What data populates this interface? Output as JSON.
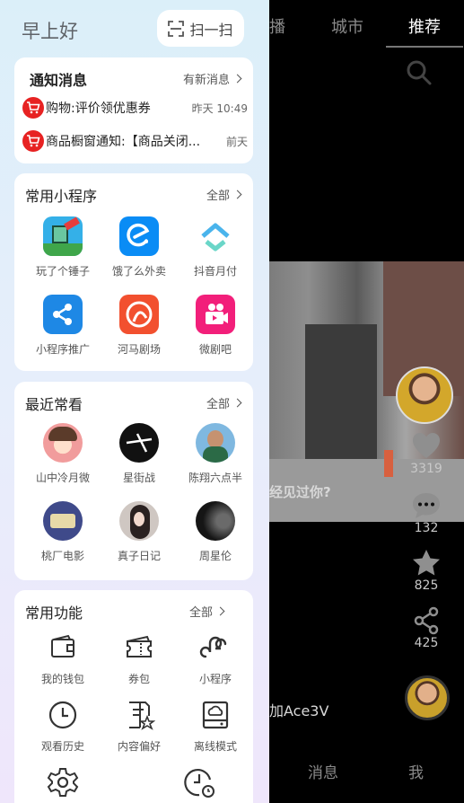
{
  "background": {
    "tabs": [
      "播",
      "城市",
      "推荐"
    ],
    "caption": "经见过你?",
    "stats": {
      "likes": "3319",
      "comments": "132",
      "favorites": "825",
      "shares": "425"
    },
    "nickname": "加Ace3V",
    "nav": [
      "消息",
      "我"
    ]
  },
  "drawer": {
    "greeting": "早上好",
    "scan_label": "扫一扫",
    "notifications": {
      "title": "通知消息",
      "more": "有新消息",
      "items": [
        {
          "text": "购物:评价领优惠券",
          "time": "昨天 10:49"
        },
        {
          "text": "商品橱窗通知:【商品关闭...",
          "time": "前天"
        }
      ]
    },
    "mini_programs": {
      "title": "常用小程序",
      "more": "全部",
      "items": [
        {
          "label": "玩了个锤子",
          "icon": "hammer-game-icon"
        },
        {
          "label": "饿了么外卖",
          "icon": "eleme-icon"
        },
        {
          "label": "抖音月付",
          "icon": "douyin-pay-icon"
        },
        {
          "label": "小程序推广",
          "icon": "share-promo-icon"
        },
        {
          "label": "河马剧场",
          "icon": "hippo-theater-icon"
        },
        {
          "label": "微剧吧",
          "icon": "video-camera-icon"
        }
      ]
    },
    "recent": {
      "title": "最近常看",
      "more": "全部",
      "items": [
        {
          "label": "山中冷月微"
        },
        {
          "label": "星街战"
        },
        {
          "label": "陈翔六点半"
        },
        {
          "label": "桃厂电影"
        },
        {
          "label": "真子日记"
        },
        {
          "label": "周星伦"
        }
      ]
    },
    "functions": {
      "title": "常用功能",
      "more": "全部",
      "items": [
        {
          "label": "我的钱包",
          "icon": "wallet-icon"
        },
        {
          "label": "券包",
          "icon": "coupon-icon"
        },
        {
          "label": "小程序",
          "icon": "mini-program-icon"
        },
        {
          "label": "观看历史",
          "icon": "history-clock-icon"
        },
        {
          "label": "内容偏好",
          "icon": "preference-icon"
        },
        {
          "label": "离线模式",
          "icon": "offline-drive-icon"
        }
      ]
    }
  }
}
